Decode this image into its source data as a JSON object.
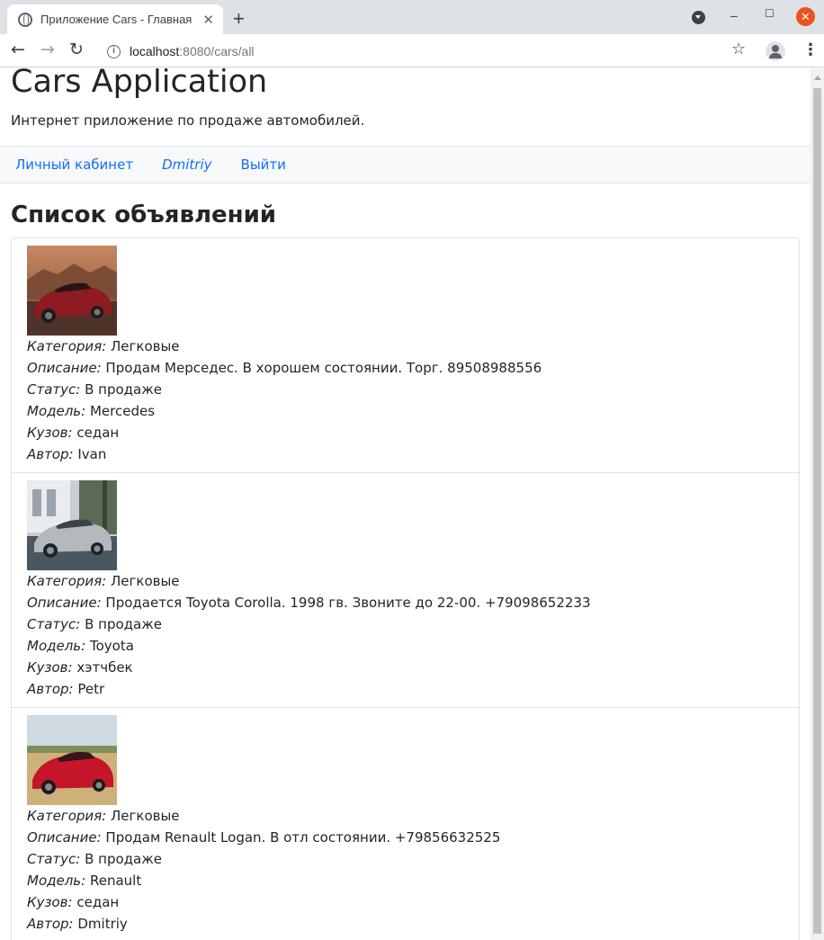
{
  "browser": {
    "tab_title": "Приложение Cars - Главная",
    "tab_close": "✕",
    "new_tab": "+",
    "minimize": "–",
    "maximize": "☐",
    "close": "✕",
    "url_host": "localhost",
    "url_path": ":8080/cars/all",
    "back": "←",
    "forward": "→",
    "reload": "↻",
    "star": "☆",
    "menu": "⋮"
  },
  "header": {
    "title": "Cars Application",
    "subtitle": "Интернет приложение по продаже автомобилей."
  },
  "nav": {
    "cabinet": "Личный кабинет",
    "user": "Dmitriy",
    "logout": "Выйти"
  },
  "main": {
    "title": "Список объявлений",
    "labels": {
      "category": "Категория:",
      "description": "Описание:",
      "status": "Статус:",
      "model": "Модель:",
      "body": "Кузов:",
      "author": "Автор:"
    },
    "ads": [
      {
        "category": "Легковые",
        "description": "Продам Мерседес. В хорошем состоянии. Торг. 89508988556",
        "status": "В продаже",
        "model": "Mercedes",
        "body": "седан",
        "author": "Ivan"
      },
      {
        "category": "Легковые",
        "description": "Продается Toyota Corolla. 1998 гв. Звоните до 22-00. +79098652233",
        "status": "В продаже",
        "model": "Toyota",
        "body": "хэтчбек",
        "author": "Petr"
      },
      {
        "category": "Легковые",
        "description": "Продам Renault Logan. В отл состоянии. +79856632525",
        "status": "В продаже",
        "model": "Renault",
        "body": "седан",
        "author": "Dmitriy"
      }
    ]
  }
}
